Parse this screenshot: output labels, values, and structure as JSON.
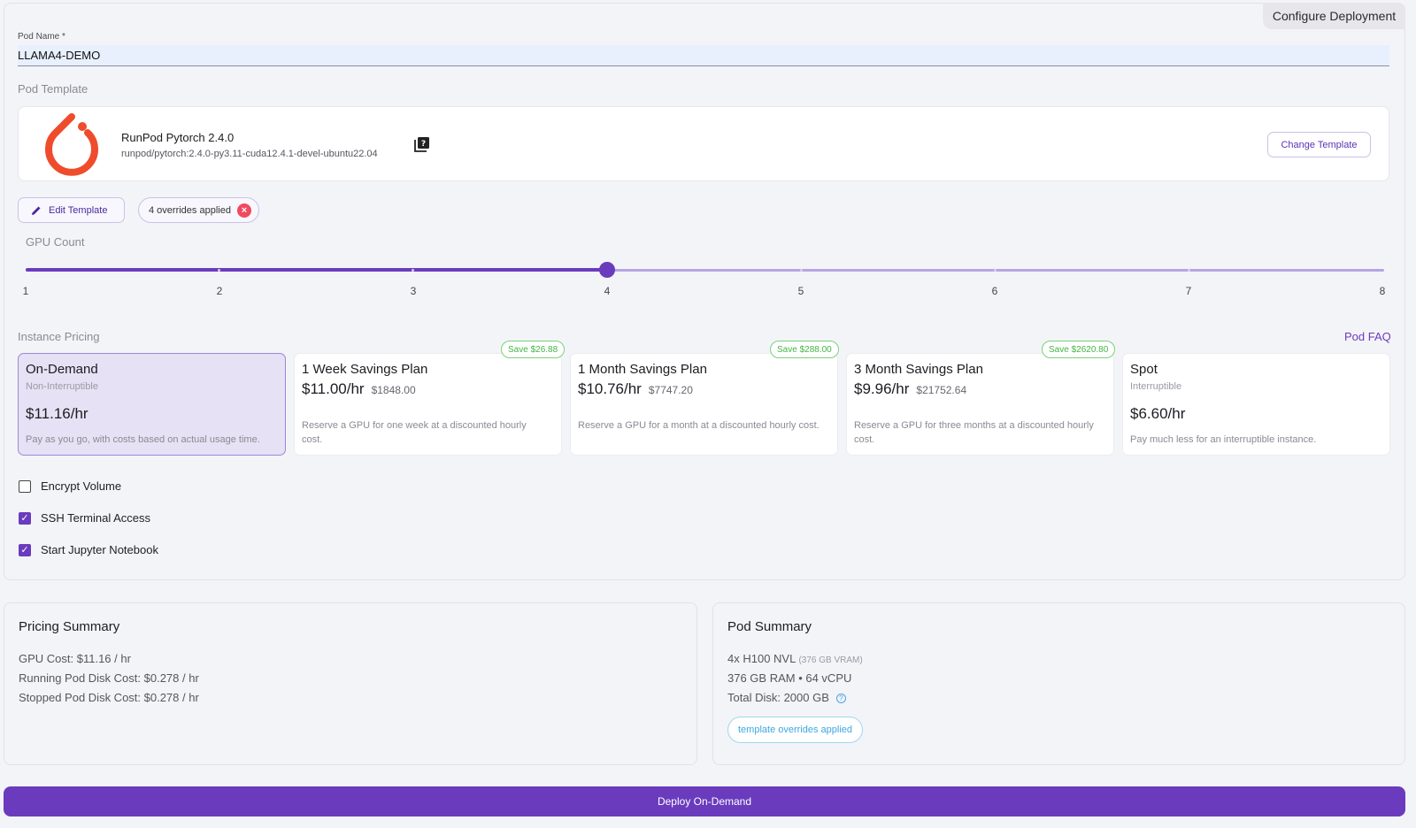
{
  "header": {
    "config_tab": "Configure Deployment"
  },
  "pod_name": {
    "label": "Pod Name *",
    "value": "LLAMA4-DEMO"
  },
  "template": {
    "section_label": "Pod Template",
    "name": "RunPod Pytorch 2.4.0",
    "image": "runpod/pytorch:2.4.0-py3.11-cuda12.4.1-devel-ubuntu22.04",
    "change_button": "Change Template",
    "edit_button": "Edit Template",
    "overrides_chip": "4 overrides applied"
  },
  "gpu_count": {
    "label": "GPU Count",
    "ticks": [
      "1",
      "2",
      "3",
      "4",
      "5",
      "6",
      "7",
      "8"
    ],
    "selected": 4
  },
  "pricing": {
    "section_label": "Instance Pricing",
    "faq_link": "Pod FAQ",
    "plans": [
      {
        "title": "On-Demand",
        "subtitle": "Non-Interruptible",
        "price": "$11.16/hr",
        "total": "",
        "description": "Pay as you go, with costs based on actual usage time.",
        "badge": ""
      },
      {
        "title": "1 Week Savings Plan",
        "subtitle": "",
        "price": "$11.00/hr",
        "total": "$1848.00",
        "description": "Reserve a GPU for one week at a discounted hourly cost.",
        "badge": "Save $26.88"
      },
      {
        "title": "1 Month Savings Plan",
        "subtitle": "",
        "price": "$10.76/hr",
        "total": "$7747.20",
        "description": "Reserve a GPU for a month at a discounted hourly cost.",
        "badge": "Save $288.00"
      },
      {
        "title": "3 Month Savings Plan",
        "subtitle": "",
        "price": "$9.96/hr",
        "total": "$21752.64",
        "description": "Reserve a GPU for three months at a discounted hourly cost.",
        "badge": "Save $2620.80"
      },
      {
        "title": "Spot",
        "subtitle": "Interruptible",
        "price": "$6.60/hr",
        "total": "",
        "description": "Pay much less for an interruptible instance.",
        "badge": ""
      }
    ]
  },
  "options": [
    {
      "label": "Encrypt Volume",
      "checked": false
    },
    {
      "label": "SSH Terminal Access",
      "checked": true
    },
    {
      "label": "Start Jupyter Notebook",
      "checked": true
    }
  ],
  "pricing_summary": {
    "title": "Pricing Summary",
    "gpu_cost": "GPU Cost: $11.16 / hr",
    "running_disk": "Running Pod Disk Cost: $0.278 / hr",
    "stopped_disk": "Stopped Pod Disk Cost: $0.278 / hr"
  },
  "pod_summary": {
    "title": "Pod Summary",
    "gpu": "4x H100 NVL",
    "vram": "(376 GB VRAM)",
    "ram_cpu": "376 GB RAM • 64 vCPU",
    "disk": "Total Disk: 2000 GB",
    "overrides_chip": "template overrides applied"
  },
  "deploy_button": "Deploy On-Demand",
  "colors": {
    "accent": "#6a3bbd",
    "save_green": "#45b445",
    "info_blue": "#3aa8e0",
    "logo_orange": "#ee4c2c"
  }
}
